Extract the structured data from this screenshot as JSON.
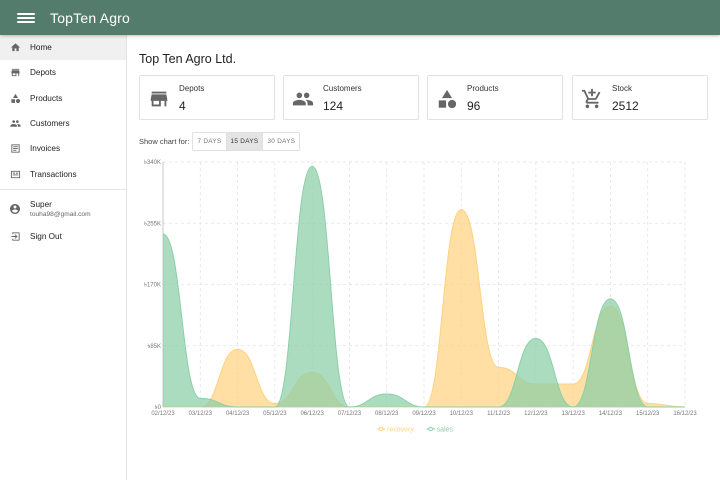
{
  "app": {
    "title": "TopTen Agro"
  },
  "sidebar": {
    "items": [
      {
        "label": "Home",
        "icon": "home-icon"
      },
      {
        "label": "Depots",
        "icon": "store-icon"
      },
      {
        "label": "Products",
        "icon": "category-icon"
      },
      {
        "label": "Customers",
        "icon": "people-icon"
      },
      {
        "label": "Invoices",
        "icon": "receipt-icon"
      },
      {
        "label": "Transactions",
        "icon": "transactions-icon"
      }
    ],
    "user": {
      "name": "Super",
      "email": "touha98@gmail.com"
    },
    "signout": "Sign Out"
  },
  "main": {
    "company": "Top Ten Agro Ltd.",
    "cards": [
      {
        "label": "Depots",
        "value": "4"
      },
      {
        "label": "Customers",
        "value": "124"
      },
      {
        "label": "Products",
        "value": "96"
      },
      {
        "label": "Stock",
        "value": "2512"
      }
    ],
    "range": {
      "label": "Show chart for:",
      "options": [
        "7 DAYS",
        "15 DAYS",
        "30 DAYS"
      ],
      "selected": "15 DAYS"
    }
  },
  "colors": {
    "appbar": "#547c6c",
    "recovery": "#ffd280",
    "sales": "#8ccfa6"
  },
  "chart_data": {
    "type": "area",
    "x": [
      "02/12/23",
      "03/12/23",
      "04/12/23",
      "05/12/23",
      "06/12/23",
      "07/12/23",
      "08/12/23",
      "09/12/23",
      "10/12/23",
      "11/12/23",
      "12/12/23",
      "13/12/23",
      "14/12/23",
      "15/12/23",
      "16/12/23"
    ],
    "series": [
      {
        "name": "recovery",
        "values": [
          0,
          0,
          80000,
          5000,
          48000,
          0,
          0,
          0,
          274000,
          55000,
          32000,
          32000,
          140000,
          5000,
          0
        ]
      },
      {
        "name": "sales",
        "values": [
          240000,
          12000,
          0,
          0,
          334000,
          0,
          18000,
          0,
          0,
          0,
          95000,
          0,
          150000,
          0,
          0
        ]
      }
    ],
    "yticks": [
      "৳0",
      "৳85K",
      "৳170K",
      "৳255K",
      "৳340K"
    ],
    "ylim": [
      0,
      340000
    ],
    "grid": true,
    "legend": "bottom-center"
  }
}
